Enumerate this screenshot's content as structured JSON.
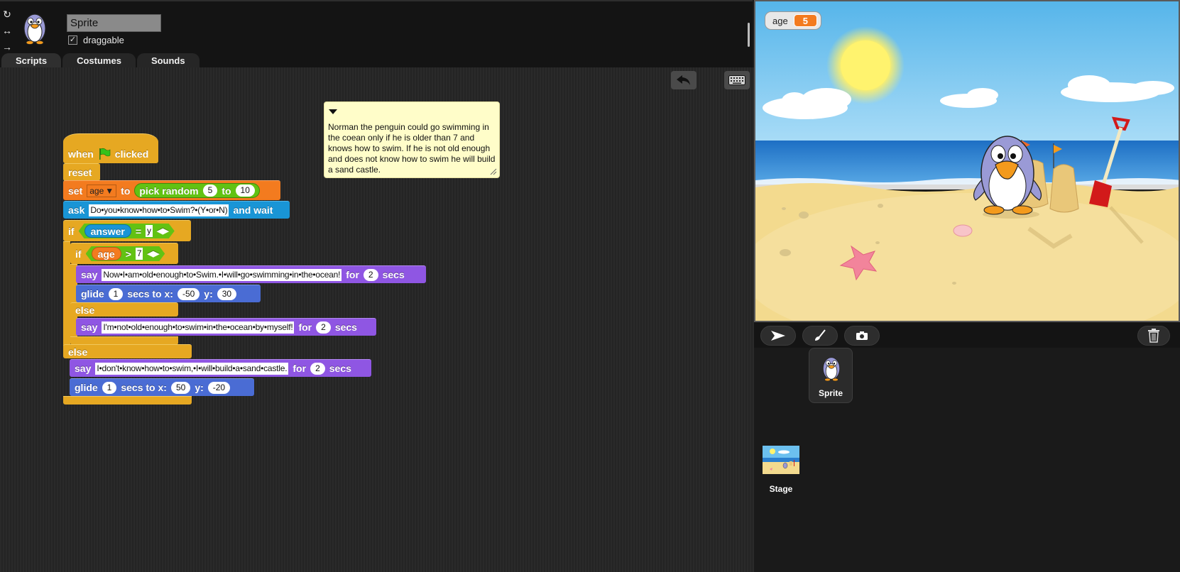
{
  "sprite": {
    "name": "Sprite",
    "draggable_label": "draggable",
    "draggable_checked": "✓"
  },
  "rotation_buttons": [
    "↻",
    "↔",
    "→"
  ],
  "tabs": [
    {
      "label": "Scripts",
      "active": true
    },
    {
      "label": "Costumes",
      "active": false
    },
    {
      "label": "Sounds",
      "active": false
    }
  ],
  "script": {
    "hat": {
      "when": "when",
      "clicked": "clicked"
    },
    "reset": "reset",
    "set": {
      "label": "set",
      "var": "age",
      "to": "to",
      "op": "pick random",
      "from": "5",
      "to2": "to",
      "to_value": "10"
    },
    "ask": {
      "label": "ask",
      "question": "Do•you•know•how•to•Swim?•(Y•or•N)",
      "wait": "and wait"
    },
    "if1": {
      "label": "if",
      "reporter": "answer",
      "eq": "=",
      "value": "y"
    },
    "if2": {
      "label": "if",
      "reporter": "age",
      "gt": ">",
      "value": "7"
    },
    "say1": {
      "label": "say",
      "text": "Now•I•am•old•enough•to•Swim.•I•will•go•swimming•in•the•ocean!",
      "for": "for",
      "secs_value": "2",
      "secs": "secs"
    },
    "glide1": {
      "label": "glide",
      "secs_value": "1",
      "secs_to_x": "secs to x:",
      "x": "-50",
      "y_label": "y:",
      "y": "30"
    },
    "else1": "else",
    "say2": {
      "label": "say",
      "text": "I'm•not•old•enough•to•swim•in•the•ocean•by•myself!",
      "for": "for",
      "secs_value": "2",
      "secs": "secs"
    },
    "else2": "else",
    "say3": {
      "label": "say",
      "text": "I•don't•know•how•to•swim,•I•will•build•a•sand•castle.",
      "for": "for",
      "secs_value": "2",
      "secs": "secs"
    },
    "glide2": {
      "label": "glide",
      "secs_value": "1",
      "secs_to_x": "secs to x:",
      "x": "50",
      "y_label": "y:",
      "y": "-20"
    }
  },
  "comment": {
    "text": "Norman the penguin could go swimming in the coean only if he is older than 7 and knows how to swim. If he is not old enough and does not know how to swim he will build a sand castle."
  },
  "watcher": {
    "label": "age",
    "value": "5"
  },
  "corral": {
    "sprite_label": "Sprite",
    "stage_label": "Stage"
  },
  "icons": {
    "undo": "undo-icon",
    "keyboard": "keyboard-icon",
    "turtle": "arrow-icon",
    "paint": "paintbrush-icon",
    "camera": "camera-icon",
    "trash": "trash-icon"
  },
  "colors": {
    "control": "#e6a822",
    "variables": "#f37b1f",
    "sensing": "#1995d6",
    "looks": "#8f56e3",
    "motion": "#4a6cd4",
    "operators": "#62c213"
  }
}
